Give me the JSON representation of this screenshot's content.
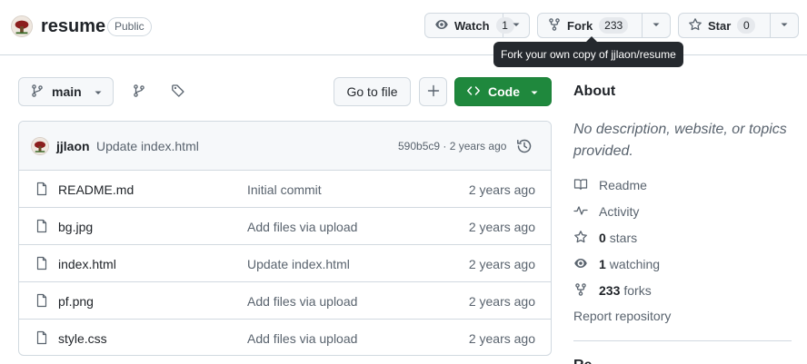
{
  "repo": {
    "name": "resume",
    "visibility": "Public"
  },
  "actions": {
    "watch": {
      "label": "Watch",
      "count": "1"
    },
    "fork": {
      "label": "Fork",
      "count": "233"
    },
    "star": {
      "label": "Star",
      "count": "0"
    }
  },
  "tooltip": "Fork your own copy of jjlaon/resume",
  "toolbar": {
    "branch": "main",
    "goto_file": "Go to file",
    "code": "Code"
  },
  "latest_commit": {
    "author": "jjlaon",
    "message": "Update index.html",
    "meta": "590b5c9 · 2 years ago"
  },
  "files": [
    {
      "name": "README.md",
      "commit": "Initial commit",
      "age": "2 years ago"
    },
    {
      "name": "bg.jpg",
      "commit": "Add files via upload",
      "age": "2 years ago"
    },
    {
      "name": "index.html",
      "commit": "Update index.html",
      "age": "2 years ago"
    },
    {
      "name": "pf.png",
      "commit": "Add files via upload",
      "age": "2 years ago"
    },
    {
      "name": "style.css",
      "commit": "Add files via upload",
      "age": "2 years ago"
    }
  ],
  "about": {
    "title": "About",
    "description": "No description, website, or topics provided.",
    "readme": "Readme",
    "activity": "Activity",
    "stars_count": "0",
    "stars_label": "stars",
    "watching_count": "1",
    "watching_label": "watching",
    "forks_count": "233",
    "forks_label": "forks",
    "report": "Report repository",
    "next_section_peek": "Re"
  },
  "colors": {
    "primary_button": "#1f883d",
    "border": "#d1d9e0",
    "muted_text": "#59636e",
    "tooltip_bg": "#25292e"
  },
  "icons": [
    "eye-icon",
    "repo-forked-icon",
    "star-icon",
    "triangle-down-icon",
    "git-branch-icon",
    "tag-icon",
    "plus-icon",
    "code-icon",
    "history-icon",
    "file-icon",
    "book-icon",
    "pulse-icon"
  ]
}
